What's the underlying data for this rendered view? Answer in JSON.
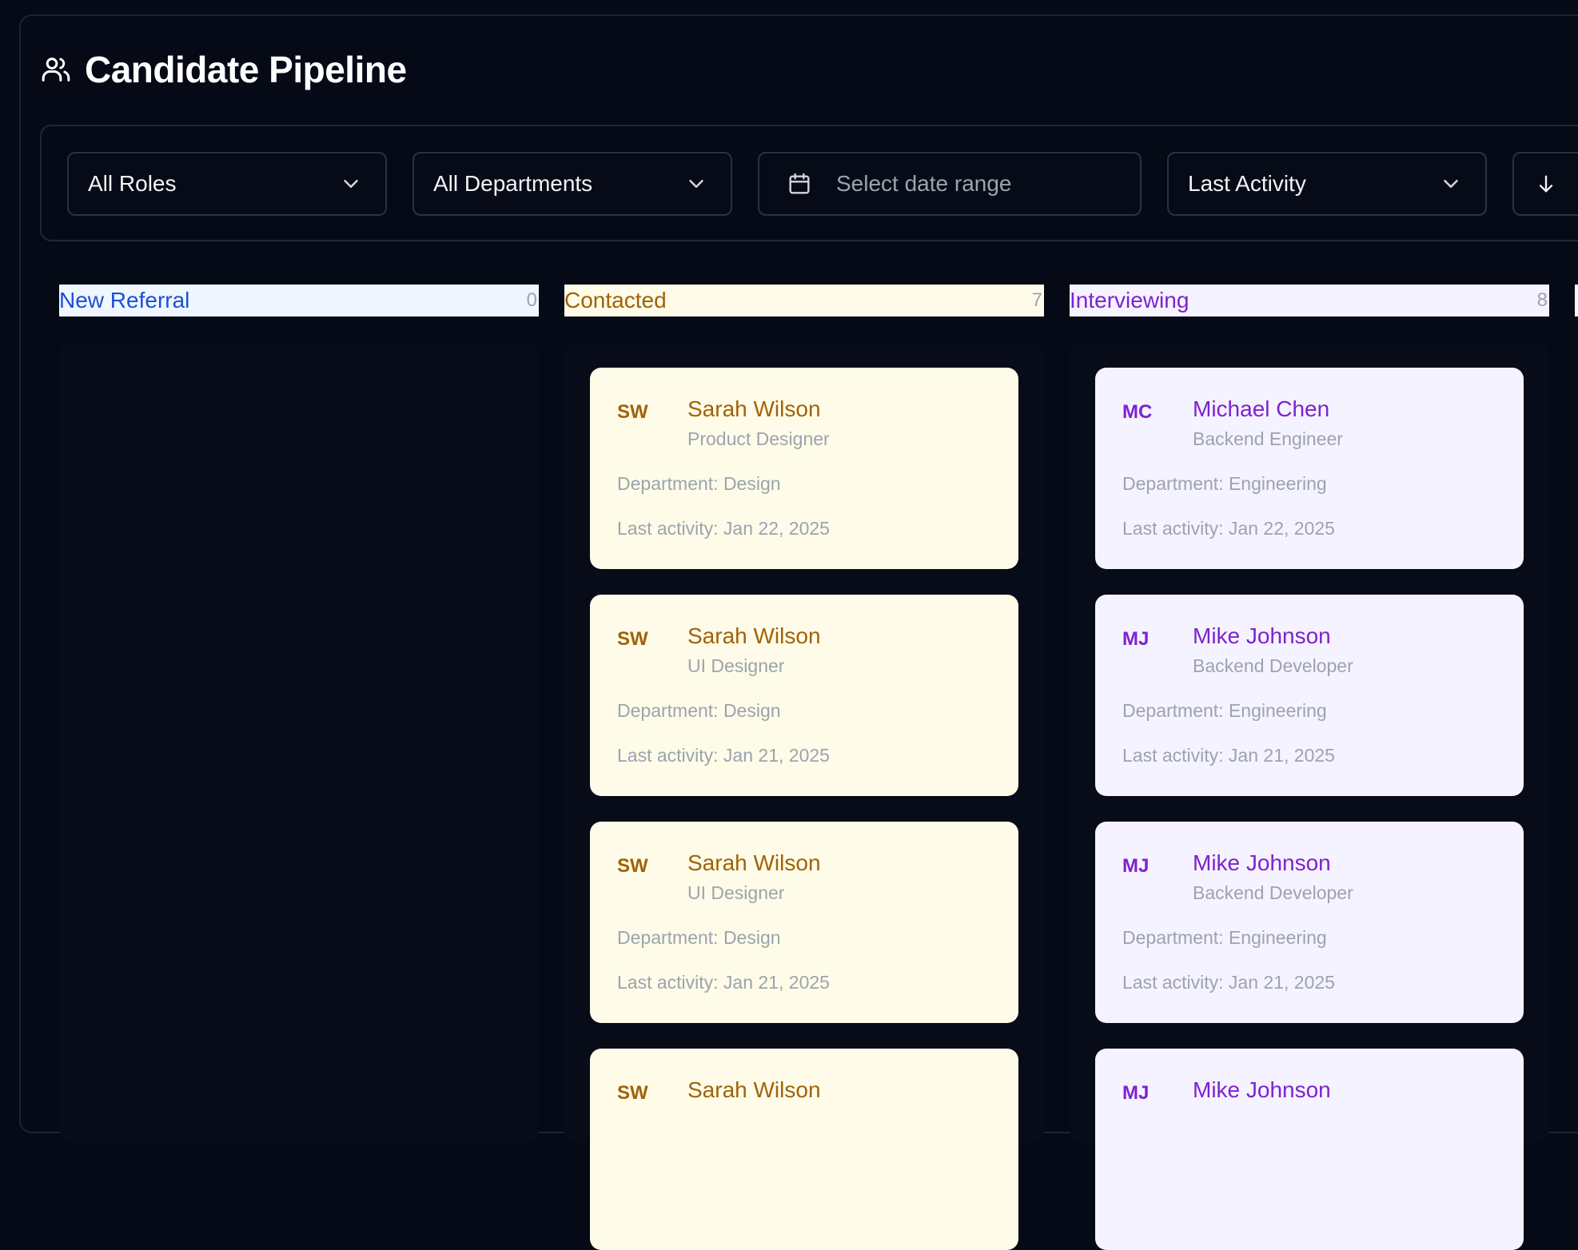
{
  "header": {
    "title": "Candidate Pipeline",
    "icon": "users-icon"
  },
  "filters": {
    "roles": "All Roles",
    "departments": "All Departments",
    "date_placeholder": "Select date range",
    "sort": "Last Activity",
    "sort_direction_icon": "arrow-down-icon"
  },
  "columns": [
    {
      "title": "New Referral",
      "count": "0",
      "header_bg": "#eff6ff",
      "header_color": "#1d4ed8",
      "cards": []
    },
    {
      "title": "Contacted",
      "count": "7",
      "header_bg": "#fefce8",
      "header_color": "#a16207",
      "cards": [
        {
          "initials": "SW",
          "name": "Sarah Wilson",
          "role": "Product Designer",
          "department": "Department: Design",
          "activity": "Last activity: Jan 22, 2025"
        },
        {
          "initials": "SW",
          "name": "Sarah Wilson",
          "role": "UI Designer",
          "department": "Department: Design",
          "activity": "Last activity: Jan 21, 2025"
        },
        {
          "initials": "SW",
          "name": "Sarah Wilson",
          "role": "UI Designer",
          "department": "Department: Design",
          "activity": "Last activity: Jan 21, 2025"
        },
        {
          "initials": "SW",
          "name": "Sarah Wilson"
        }
      ]
    },
    {
      "title": "Interviewing",
      "count": "8",
      "header_bg": "#f5f3ff",
      "header_color": "#7e22ce",
      "cards": [
        {
          "initials": "MC",
          "name": "Michael Chen",
          "role": "Backend Engineer",
          "department": "Department: Engineering",
          "activity": "Last activity: Jan 22, 2025"
        },
        {
          "initials": "MJ",
          "name": "Mike Johnson",
          "role": "Backend Developer",
          "department": "Department: Engineering",
          "activity": "Last activity: Jan 21, 2025"
        },
        {
          "initials": "MJ",
          "name": "Mike Johnson",
          "role": "Backend Developer",
          "department": "Department: Engineering",
          "activity": "Last activity: Jan 21, 2025"
        },
        {
          "initials": "MJ",
          "name": "Mike Johnson"
        }
      ]
    }
  ]
}
